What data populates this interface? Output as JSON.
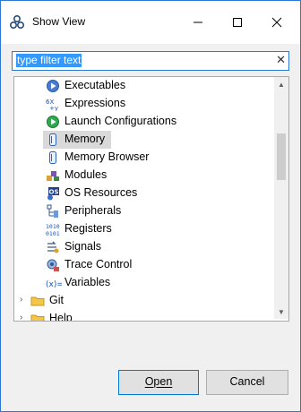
{
  "dialog": {
    "title": "Show View"
  },
  "filter": {
    "value": "type filter text"
  },
  "tree": {
    "items": [
      {
        "label": "Executables",
        "icon": "executables-icon",
        "selected": false
      },
      {
        "label": "Expressions",
        "icon": "expressions-icon",
        "selected": false
      },
      {
        "label": "Launch Configurations",
        "icon": "launch-configurations-icon",
        "selected": false
      },
      {
        "label": "Memory",
        "icon": "memory-icon",
        "selected": true
      },
      {
        "label": "Memory Browser",
        "icon": "memory-browser-icon",
        "selected": false
      },
      {
        "label": "Modules",
        "icon": "modules-icon",
        "selected": false
      },
      {
        "label": "OS Resources",
        "icon": "os-resources-icon",
        "selected": false
      },
      {
        "label": "Peripherals",
        "icon": "peripherals-icon",
        "selected": false
      },
      {
        "label": "Registers",
        "icon": "registers-icon",
        "selected": false
      },
      {
        "label": "Signals",
        "icon": "signals-icon",
        "selected": false
      },
      {
        "label": "Trace Control",
        "icon": "trace-control-icon",
        "selected": false
      },
      {
        "label": "Variables",
        "icon": "variables-icon",
        "selected": false
      }
    ],
    "folders": [
      {
        "label": "Git",
        "icon": "folder-icon"
      },
      {
        "label": "Help",
        "icon": "folder-icon"
      }
    ]
  },
  "buttons": {
    "open": "Open",
    "cancel": "Cancel"
  },
  "colors": {
    "accent": "#2b78d6",
    "selection": "#d9d9d9",
    "filter_highlight": "#3399ff"
  }
}
